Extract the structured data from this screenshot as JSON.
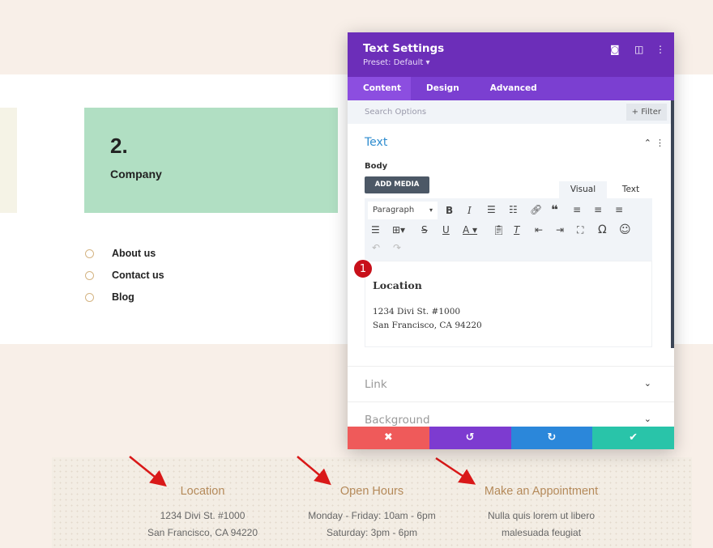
{
  "page": {
    "card": {
      "number": "2.",
      "label": "Company"
    },
    "links": [
      "About us",
      "Contact us",
      "Blog"
    ],
    "footer": [
      {
        "title": "Location",
        "lines": [
          "1234 Divi St. #1000",
          "San Francisco, CA 94220"
        ]
      },
      {
        "title": "Open Hours",
        "lines": [
          "Monday - Friday: 10am - 6pm",
          "Saturday: 3pm - 6pm"
        ]
      },
      {
        "title": "Make an Appointment",
        "lines": [
          "Nulla quis lorem ut libero",
          "malesuada feugiat"
        ]
      }
    ]
  },
  "modal": {
    "title": "Text Settings",
    "preset": "Preset: Default ▾",
    "tabs": [
      "Content",
      "Design",
      "Advanced"
    ],
    "search_placeholder": "Search Options",
    "filter": "+ Filter",
    "section": "Text",
    "body_label": "Body",
    "add_media": "ADD MEDIA",
    "editor_tabs": [
      "Visual",
      "Text"
    ],
    "paragraph": "Paragraph",
    "content": {
      "heading": "Location",
      "lines": [
        "1234 Divi St. #1000",
        "San Francisco, CA 94220"
      ]
    },
    "badge": "1",
    "sections": [
      "Link",
      "Background"
    ]
  },
  "colors": {
    "header": "#6c2eb9",
    "tabs": "#7b3fd1",
    "cancel": "#ef5a5a",
    "undo": "#7d3bd0",
    "redo": "#2b87da",
    "save": "#29c4a9",
    "card": "#b1dfc3"
  }
}
